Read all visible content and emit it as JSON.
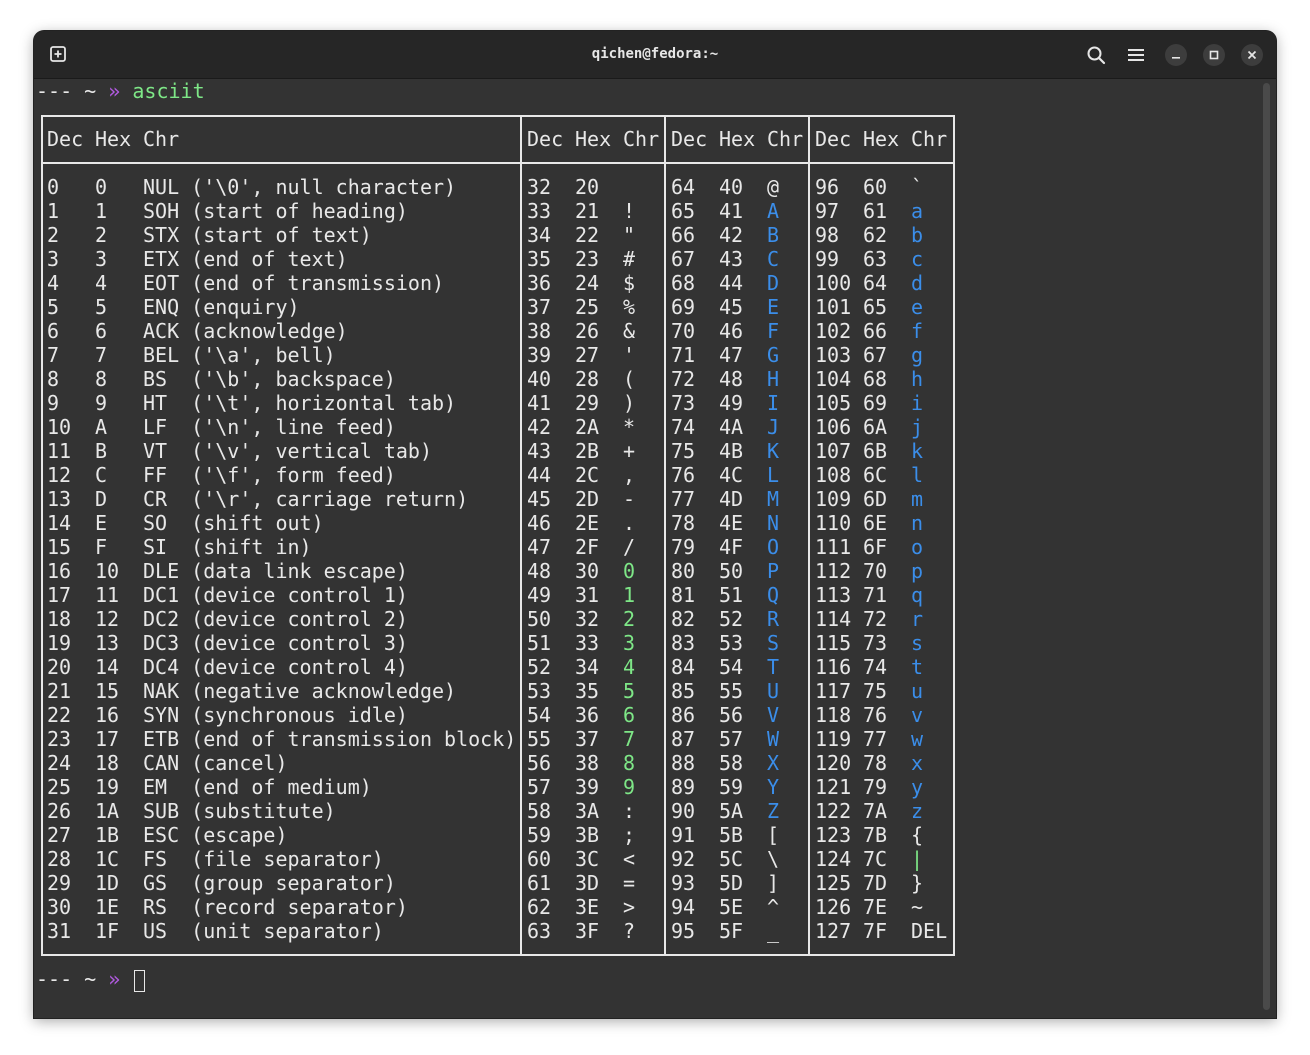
{
  "window": {
    "title": "qichen@fedora:~"
  },
  "icons": {
    "new_tab": "new-tab-icon",
    "search": "search-icon",
    "menu": "hamburger-menu-icon",
    "minimize": "minimize-icon",
    "maximize": "maximize-icon",
    "close": "close-icon"
  },
  "colors": {
    "terminal_bg": "#333333",
    "titlebar_bg": "#262626",
    "prompt_arrow": "#b15ae0",
    "command_green": "#7ee787",
    "digit_green": "#7ee787",
    "letter_blue": "#3b8eea",
    "text": "#e8e8e8"
  },
  "prompt": {
    "dashes": "---",
    "tilde": "~",
    "arrow": "»",
    "command": "asciit"
  },
  "table": {
    "headers": {
      "dec": "Dec",
      "hex": "Hex",
      "chr": "Chr"
    },
    "columns": [
      [
        [
          "0",
          "0",
          "NUL ('\\0', null character)"
        ],
        [
          "1",
          "1",
          "SOH (start of heading)"
        ],
        [
          "2",
          "2",
          "STX (start of text)"
        ],
        [
          "3",
          "3",
          "ETX (end of text)"
        ],
        [
          "4",
          "4",
          "EOT (end of transmission)"
        ],
        [
          "5",
          "5",
          "ENQ (enquiry)"
        ],
        [
          "6",
          "6",
          "ACK (acknowledge)"
        ],
        [
          "7",
          "7",
          "BEL ('\\a', bell)"
        ],
        [
          "8",
          "8",
          "BS  ('\\b', backspace)"
        ],
        [
          "9",
          "9",
          "HT  ('\\t', horizontal tab)"
        ],
        [
          "10",
          "A",
          "LF  ('\\n', line feed)"
        ],
        [
          "11",
          "B",
          "VT  ('\\v', vertical tab)"
        ],
        [
          "12",
          "C",
          "FF  ('\\f', form feed)"
        ],
        [
          "13",
          "D",
          "CR  ('\\r', carriage return)"
        ],
        [
          "14",
          "E",
          "SO  (shift out)"
        ],
        [
          "15",
          "F",
          "SI  (shift in)"
        ],
        [
          "16",
          "10",
          "DLE (data link escape)"
        ],
        [
          "17",
          "11",
          "DC1 (device control 1)"
        ],
        [
          "18",
          "12",
          "DC2 (device control 2)"
        ],
        [
          "19",
          "13",
          "DC3 (device control 3)"
        ],
        [
          "20",
          "14",
          "DC4 (device control 4)"
        ],
        [
          "21",
          "15",
          "NAK (negative acknowledge)"
        ],
        [
          "22",
          "16",
          "SYN (synchronous idle)"
        ],
        [
          "23",
          "17",
          "ETB (end of transmission block)"
        ],
        [
          "24",
          "18",
          "CAN (cancel)"
        ],
        [
          "25",
          "19",
          "EM  (end of medium)"
        ],
        [
          "26",
          "1A",
          "SUB (substitute)"
        ],
        [
          "27",
          "1B",
          "ESC (escape)"
        ],
        [
          "28",
          "1C",
          "FS  (file separator)"
        ],
        [
          "29",
          "1D",
          "GS  (group separator)"
        ],
        [
          "30",
          "1E",
          "RS  (record separator)"
        ],
        [
          "31",
          "1F",
          "US  (unit separator)"
        ]
      ],
      [
        [
          "32",
          "20",
          " "
        ],
        [
          "33",
          "21",
          "!"
        ],
        [
          "34",
          "22",
          "\""
        ],
        [
          "35",
          "23",
          "#"
        ],
        [
          "36",
          "24",
          "$"
        ],
        [
          "37",
          "25",
          "%"
        ],
        [
          "38",
          "26",
          "&"
        ],
        [
          "39",
          "27",
          "'"
        ],
        [
          "40",
          "28",
          "("
        ],
        [
          "41",
          "29",
          ")"
        ],
        [
          "42",
          "2A",
          "*"
        ],
        [
          "43",
          "2B",
          "+"
        ],
        [
          "44",
          "2C",
          ","
        ],
        [
          "45",
          "2D",
          "-"
        ],
        [
          "46",
          "2E",
          "."
        ],
        [
          "47",
          "2F",
          "/"
        ],
        [
          "48",
          "30",
          "0"
        ],
        [
          "49",
          "31",
          "1"
        ],
        [
          "50",
          "32",
          "2"
        ],
        [
          "51",
          "33",
          "3"
        ],
        [
          "52",
          "34",
          "4"
        ],
        [
          "53",
          "35",
          "5"
        ],
        [
          "54",
          "36",
          "6"
        ],
        [
          "55",
          "37",
          "7"
        ],
        [
          "56",
          "38",
          "8"
        ],
        [
          "57",
          "39",
          "9"
        ],
        [
          "58",
          "3A",
          ":"
        ],
        [
          "59",
          "3B",
          ";"
        ],
        [
          "60",
          "3C",
          "<"
        ],
        [
          "61",
          "3D",
          "="
        ],
        [
          "62",
          "3E",
          ">"
        ],
        [
          "63",
          "3F",
          "?"
        ]
      ],
      [
        [
          "64",
          "40",
          "@"
        ],
        [
          "65",
          "41",
          "A"
        ],
        [
          "66",
          "42",
          "B"
        ],
        [
          "67",
          "43",
          "C"
        ],
        [
          "68",
          "44",
          "D"
        ],
        [
          "69",
          "45",
          "E"
        ],
        [
          "70",
          "46",
          "F"
        ],
        [
          "71",
          "47",
          "G"
        ],
        [
          "72",
          "48",
          "H"
        ],
        [
          "73",
          "49",
          "I"
        ],
        [
          "74",
          "4A",
          "J"
        ],
        [
          "75",
          "4B",
          "K"
        ],
        [
          "76",
          "4C",
          "L"
        ],
        [
          "77",
          "4D",
          "M"
        ],
        [
          "78",
          "4E",
          "N"
        ],
        [
          "79",
          "4F",
          "O"
        ],
        [
          "80",
          "50",
          "P"
        ],
        [
          "81",
          "51",
          "Q"
        ],
        [
          "82",
          "52",
          "R"
        ],
        [
          "83",
          "53",
          "S"
        ],
        [
          "84",
          "54",
          "T"
        ],
        [
          "85",
          "55",
          "U"
        ],
        [
          "86",
          "56",
          "V"
        ],
        [
          "87",
          "57",
          "W"
        ],
        [
          "88",
          "58",
          "X"
        ],
        [
          "89",
          "59",
          "Y"
        ],
        [
          "90",
          "5A",
          "Z"
        ],
        [
          "91",
          "5B",
          "["
        ],
        [
          "92",
          "5C",
          "\\"
        ],
        [
          "93",
          "5D",
          "]"
        ],
        [
          "94",
          "5E",
          "^"
        ],
        [
          "95",
          "5F",
          "_"
        ]
      ],
      [
        [
          "96",
          "60",
          "`"
        ],
        [
          "97",
          "61",
          "a"
        ],
        [
          "98",
          "62",
          "b"
        ],
        [
          "99",
          "63",
          "c"
        ],
        [
          "100",
          "64",
          "d"
        ],
        [
          "101",
          "65",
          "e"
        ],
        [
          "102",
          "66",
          "f"
        ],
        [
          "103",
          "67",
          "g"
        ],
        [
          "104",
          "68",
          "h"
        ],
        [
          "105",
          "69",
          "i"
        ],
        [
          "106",
          "6A",
          "j"
        ],
        [
          "107",
          "6B",
          "k"
        ],
        [
          "108",
          "6C",
          "l"
        ],
        [
          "109",
          "6D",
          "m"
        ],
        [
          "110",
          "6E",
          "n"
        ],
        [
          "111",
          "6F",
          "o"
        ],
        [
          "112",
          "70",
          "p"
        ],
        [
          "113",
          "71",
          "q"
        ],
        [
          "114",
          "72",
          "r"
        ],
        [
          "115",
          "73",
          "s"
        ],
        [
          "116",
          "74",
          "t"
        ],
        [
          "117",
          "75",
          "u"
        ],
        [
          "118",
          "76",
          "v"
        ],
        [
          "119",
          "77",
          "w"
        ],
        [
          "120",
          "78",
          "x"
        ],
        [
          "121",
          "79",
          "y"
        ],
        [
          "122",
          "7A",
          "z"
        ],
        [
          "123",
          "7B",
          "{"
        ],
        [
          "124",
          "7C",
          "|"
        ],
        [
          "125",
          "7D",
          "}"
        ],
        [
          "126",
          "7E",
          "~"
        ],
        [
          "127",
          "7F",
          "DEL"
        ]
      ]
    ]
  }
}
